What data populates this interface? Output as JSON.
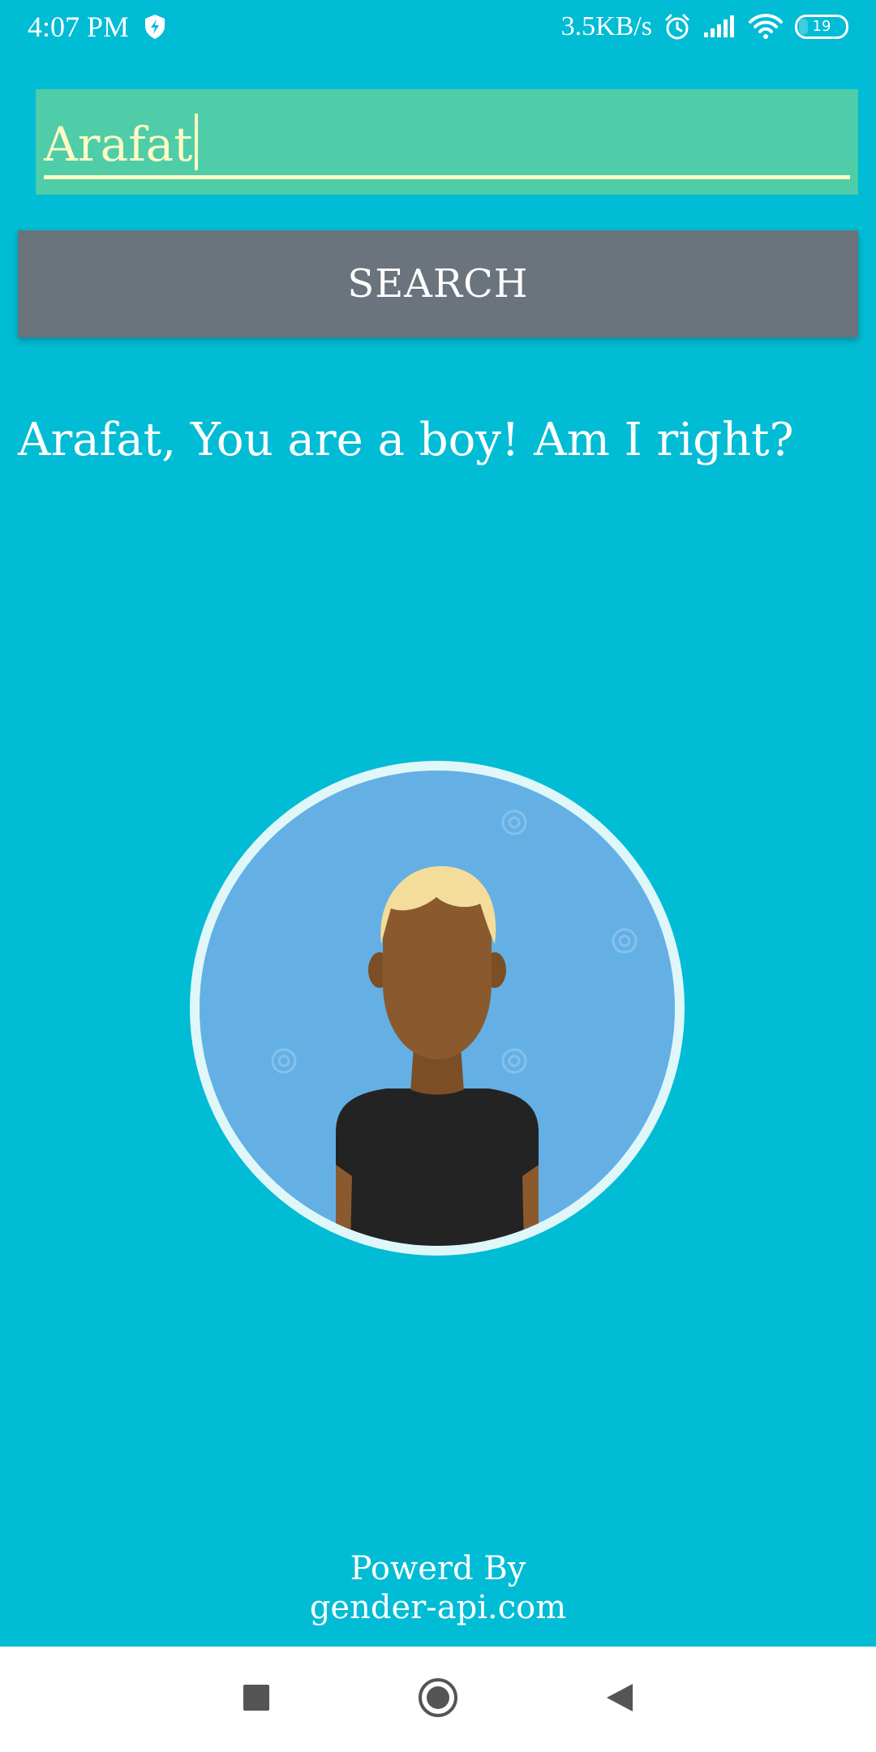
{
  "status_bar": {
    "time": "4:07 PM",
    "network_speed": "3.5KB/s",
    "battery_level": "19",
    "icons": [
      "shield-icon",
      "alarm-icon",
      "signal-icon",
      "wifi-icon",
      "battery-icon"
    ]
  },
  "search": {
    "value": "Arafat",
    "button_label": "SEARCH"
  },
  "result": {
    "message": "Arafat, You are a boy! Am I right?",
    "avatar": "boy-avatar"
  },
  "footer": {
    "line1": "Powerd By",
    "line2": "gender-api.com"
  },
  "nav_bar": {
    "icons": [
      "recents-icon",
      "home-icon",
      "back-icon"
    ]
  },
  "colors": {
    "background": "#00BCD4",
    "input_background": "#4ECDA8",
    "input_text": "#FFF9C4",
    "button": "#6B737C",
    "avatar_background": "#64B0E4"
  }
}
